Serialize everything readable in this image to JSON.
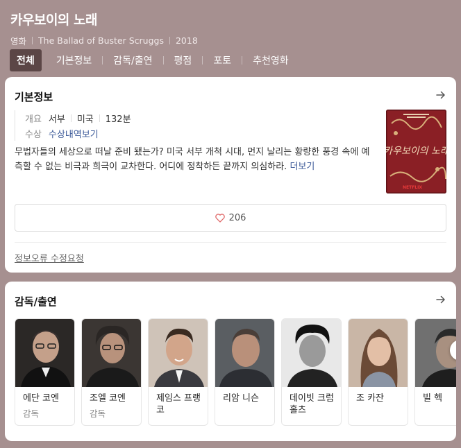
{
  "header": {
    "title": "카우보이의 노래",
    "genre": "영화",
    "original_title": "The Ballad of Buster Scruggs",
    "year": "2018"
  },
  "tabs": [
    {
      "label": "전체",
      "active": true
    },
    {
      "label": "기본정보"
    },
    {
      "label": "감독/출연"
    },
    {
      "label": "평점"
    },
    {
      "label": "포토"
    },
    {
      "label": "추천영화"
    }
  ],
  "basic_info": {
    "heading": "기본정보",
    "overview_key": "개요",
    "genre": "서부",
    "country": "미국",
    "runtime": "132분",
    "award_key": "수상",
    "award_link": "수상내역보기",
    "description": "무법자들의 세상으로 떠날 준비 됐는가? 미국 서부 개척 시대, 먼지 날리는 황량한 풍경 속에 예측할 수 없는 비극과 희극이 교차한다. 어디에 정착하든 끝까지 의심하라.",
    "more": "더보기",
    "likes": "206",
    "report": "정보오류 수정요청",
    "poster_text": "카우보이의 노래",
    "poster_brand": "NETFLIX"
  },
  "cast": {
    "heading": "감독/출연",
    "people": [
      {
        "name": "에단 코엔",
        "role": "감독"
      },
      {
        "name": "조엘 코엔",
        "role": "감독"
      },
      {
        "name": "제임스 프랭코",
        "role": ""
      },
      {
        "name": "리암 니슨",
        "role": ""
      },
      {
        "name": "데이빗 크럼홀츠",
        "role": ""
      },
      {
        "name": "조 카잔",
        "role": ""
      },
      {
        "name": "빌 헥",
        "role": ""
      }
    ]
  },
  "colors": {
    "header_bg": "#a69090",
    "active_tab": "#5b4646",
    "link": "#3b5998",
    "heart": "#e06b6b"
  }
}
